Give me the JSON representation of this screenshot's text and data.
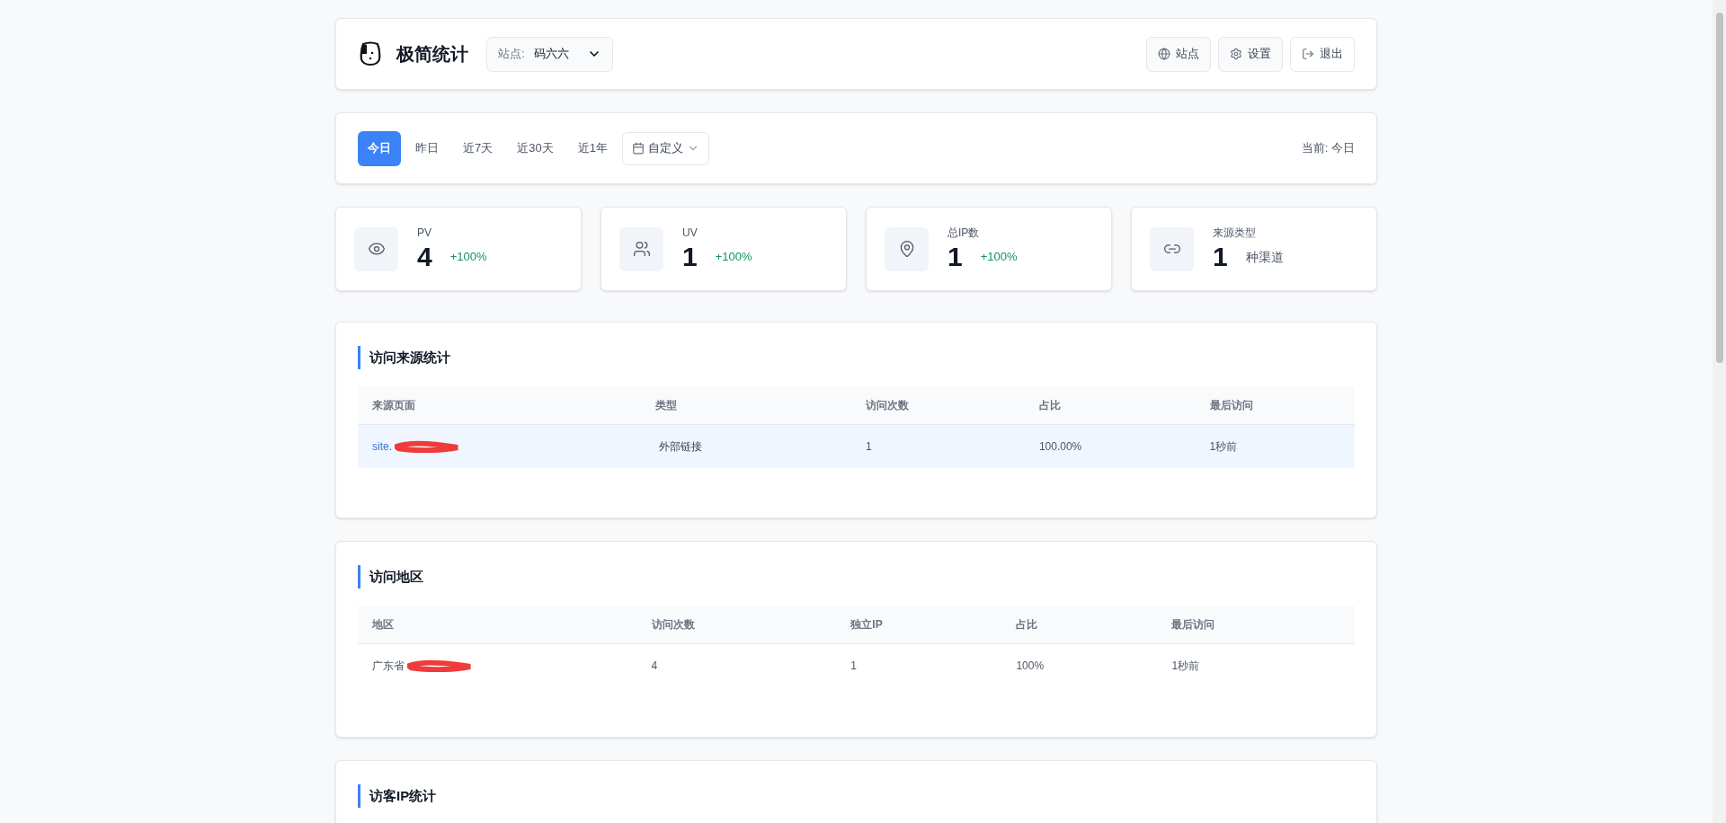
{
  "header": {
    "title": "极简统计",
    "site_select": {
      "label": "站点:",
      "value": "码六六"
    },
    "buttons": [
      {
        "kind": "globe",
        "label": "站点"
      },
      {
        "kind": "gear",
        "label": "设置"
      },
      {
        "kind": "logout",
        "label": "退出"
      }
    ]
  },
  "range": {
    "options": [
      {
        "label": "今日",
        "selected": true
      },
      {
        "label": "昨日",
        "selected": false
      },
      {
        "label": "近7天",
        "selected": false
      },
      {
        "label": "近30天",
        "selected": false
      },
      {
        "label": "近1年",
        "selected": false
      }
    ],
    "custom": "自定义",
    "current": "当前: 今日"
  },
  "stats": [
    {
      "kind": "eye",
      "label": "PV",
      "value": "4",
      "change": "+100%"
    },
    {
      "kind": "users",
      "label": "UV",
      "value": "1",
      "change": "+100%"
    },
    {
      "kind": "pin",
      "label": "总IP数",
      "value": "1",
      "change": "+100%"
    },
    {
      "kind": "link",
      "label": "来源类型",
      "value": "1",
      "unit": "种渠道"
    }
  ],
  "sections": [
    {
      "title": "访问来源统计",
      "columns": [
        "来源页面",
        "类型",
        "访问次数",
        "占比",
        "最后访问"
      ],
      "rows": [
        {
          "highlighted": true,
          "cells": [
            {
              "kind": "link",
              "text": "site.",
              "redacted": true
            },
            {
              "kind": "tag",
              "text": "外部链接"
            },
            {
              "kind": "text",
              "text": "1"
            },
            {
              "kind": "text",
              "text": "100.00%"
            },
            {
              "kind": "text",
              "text": "1秒前"
            }
          ]
        }
      ]
    },
    {
      "title": "访问地区",
      "columns": [
        "地区",
        "访问次数",
        "独立IP",
        "占比",
        "最后访问"
      ],
      "rows": [
        {
          "highlighted": false,
          "cells": [
            {
              "kind": "text",
              "text": "广东省",
              "redacted": true
            },
            {
              "kind": "text",
              "text": "4"
            },
            {
              "kind": "text",
              "text": "1"
            },
            {
              "kind": "text",
              "text": "100%"
            },
            {
              "kind": "text",
              "text": "1秒前"
            }
          ]
        }
      ]
    },
    {
      "title": "访客IP统计"
    }
  ]
}
